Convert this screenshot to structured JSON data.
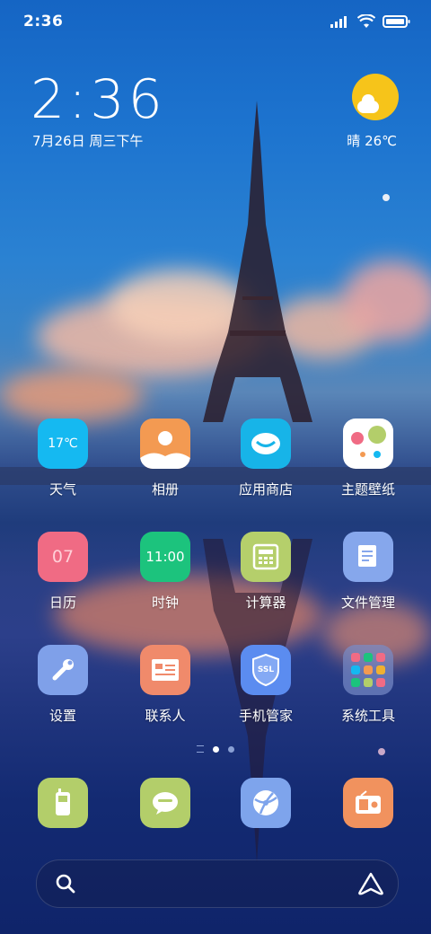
{
  "status": {
    "time": "2:36"
  },
  "clock": {
    "time": "2:36",
    "date": "7月26日 周三下午"
  },
  "weather": {
    "text": "晴 26℃"
  },
  "apps": [
    {
      "label": "天气",
      "icon": "weather-app-icon",
      "badge": "17℃",
      "color": "#15b9f1"
    },
    {
      "label": "相册",
      "icon": "gallery-app-icon",
      "color": "#f39a52"
    },
    {
      "label": "应用商店",
      "icon": "app-store-icon",
      "color": "#17b4e8"
    },
    {
      "label": "主题壁纸",
      "icon": "themes-app-icon",
      "color": "#ffffff"
    },
    {
      "label": "日历",
      "icon": "calendar-app-icon",
      "badge": "07",
      "color": "#f06b84"
    },
    {
      "label": "时钟",
      "icon": "clock-app-icon",
      "badge": "11:00",
      "color": "#1cc37d"
    },
    {
      "label": "计算器",
      "icon": "calculator-app-icon",
      "color": "#b5cf6b"
    },
    {
      "label": "文件管理",
      "icon": "file-manager-icon",
      "color": "#86a7ec"
    },
    {
      "label": "设置",
      "icon": "settings-app-icon",
      "color": "#7fa0e9"
    },
    {
      "label": "联系人",
      "icon": "contacts-app-icon",
      "color": "#f08a6b"
    },
    {
      "label": "手机管家",
      "icon": "security-app-icon",
      "badge": "SSL",
      "color": "#5b8cf0"
    },
    {
      "label": "系统工具",
      "icon": "system-tools-folder-icon",
      "color": "#6d7fb8"
    }
  ],
  "dock": [
    {
      "icon": "phone-app-icon",
      "color": "#b3ce6a"
    },
    {
      "icon": "messages-app-icon",
      "color": "#b3ce6a"
    },
    {
      "icon": "browser-app-icon",
      "color": "#7ea4ec"
    },
    {
      "icon": "music-app-icon",
      "color": "#f1925e"
    }
  ],
  "search": {
    "left_icon": "search-icon",
    "right_icon": "assistant-icon"
  }
}
